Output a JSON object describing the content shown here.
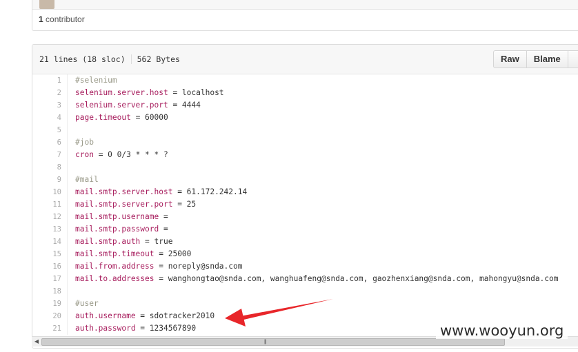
{
  "repo": {
    "contributors_count": "1",
    "contributors_label": "contributor"
  },
  "file": {
    "lines_info": "21 lines (18 sloc)",
    "size": "562 Bytes",
    "buttons": {
      "raw": "Raw",
      "blame": "Blame"
    }
  },
  "code_lines": [
    {
      "n": "1",
      "k": "#selenium",
      "v": "",
      "comment": true
    },
    {
      "n": "2",
      "k": "selenium.server.host",
      "v": " = localhost"
    },
    {
      "n": "3",
      "k": "selenium.server.port",
      "v": " = 4444"
    },
    {
      "n": "4",
      "k": "page.timeout",
      "v": " = 60000"
    },
    {
      "n": "5",
      "k": "",
      "v": ""
    },
    {
      "n": "6",
      "k": "#job",
      "v": "",
      "comment": true
    },
    {
      "n": "7",
      "k": "cron",
      "v": " = 0 0/3 * * * ?"
    },
    {
      "n": "8",
      "k": "",
      "v": ""
    },
    {
      "n": "9",
      "k": "#mail",
      "v": "",
      "comment": true
    },
    {
      "n": "10",
      "k": "mail.smtp.server.host",
      "v": " = 61.172.242.14"
    },
    {
      "n": "11",
      "k": "mail.smtp.server.port",
      "v": " = 25"
    },
    {
      "n": "12",
      "k": "mail.smtp.username",
      "v": " ="
    },
    {
      "n": "13",
      "k": "mail.smtp.password",
      "v": " ="
    },
    {
      "n": "14",
      "k": "mail.smtp.auth",
      "v": " = true"
    },
    {
      "n": "15",
      "k": "mail.smtp.timeout",
      "v": " = 25000"
    },
    {
      "n": "16",
      "k": "mail.from.address",
      "v": " = noreply@snda.com"
    },
    {
      "n": "17",
      "k": "mail.to.addresses",
      "v": " = wanghongtao@snda.com, wanghuafeng@snda.com, gaozhenxiang@snda.com, mahongyu@snda.com"
    },
    {
      "n": "18",
      "k": "",
      "v": ""
    },
    {
      "n": "19",
      "k": "#user",
      "v": "",
      "comment": true
    },
    {
      "n": "20",
      "k": "auth.username",
      "v": " = sdotracker2010"
    },
    {
      "n": "21",
      "k": "auth.password",
      "v": " = 1234567890"
    }
  ],
  "watermark": "www.wooyun.org",
  "colors": {
    "key": "#a71d5d",
    "comment": "#999988",
    "arrow": "#e8262a"
  }
}
